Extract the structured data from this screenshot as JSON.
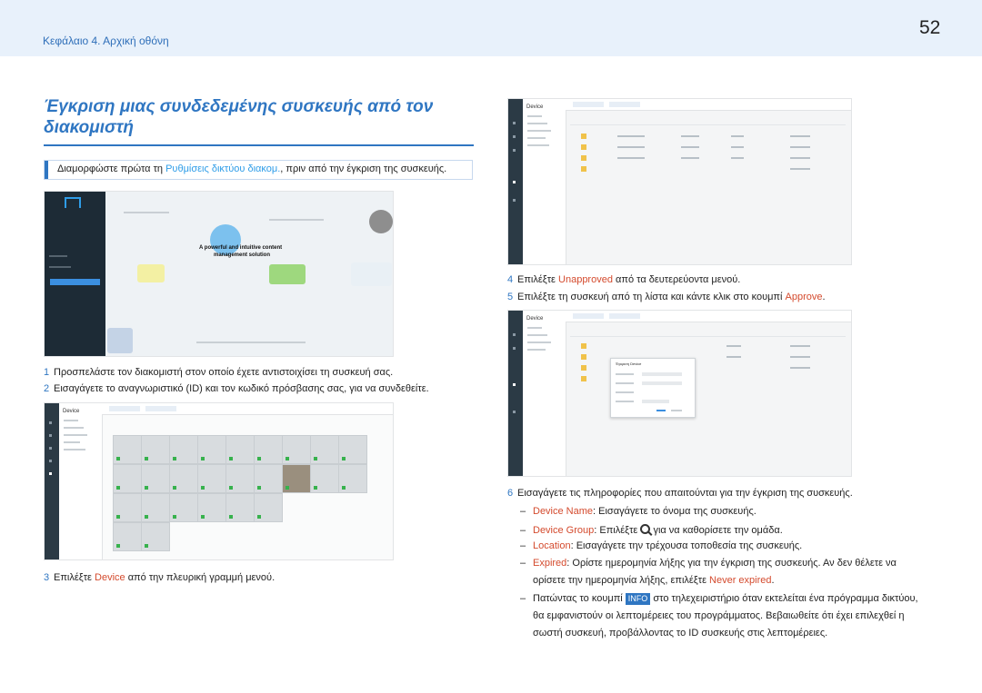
{
  "header": {
    "chapter": "Κεφάλαιο 4. Αρχική οθόνη",
    "page_number": "52"
  },
  "title": "Έγκριση μιας συνδεδεμένης συσκευής από τον διακομιστή",
  "note": {
    "prefix": "Διαμορφώστε πρώτα τη ",
    "link": "Ρυθμίσεις δικτύου διακομ.",
    "suffix": ", πριν από την έγκριση της συσκευής."
  },
  "login_screen": {
    "headline1": "A powerful and intuitive content",
    "headline2": "management solution"
  },
  "steps": [
    {
      "num": "1",
      "text": "Προσπελάστε τον διακομιστή στον οποίο έχετε αντιστοιχίσει τη συσκευή σας."
    },
    {
      "num": "2",
      "text": "Εισαγάγετε το αναγνωριστικό (ID) και τον κωδικό πρόσβασης σας, για να συνδεθείτε."
    },
    {
      "num": "3",
      "pre": "Επιλέξτε ",
      "hl": "Device",
      "post": " από την πλευρική γραμμή μενού."
    },
    {
      "num": "4",
      "pre": "Επιλέξτε ",
      "hl": "Unapproved",
      "post": " από τα δευτερεύοντα μενού."
    },
    {
      "num": "5",
      "pre": "Επιλέξτε τη συσκευή από τη λίστα και κάντε κλικ στο κουμπί ",
      "hl": "Approve",
      "post": "."
    },
    {
      "num": "6",
      "text": "Εισαγάγετε τις πληροφορίες που απαιτούνται για την έγκριση της συσκευής."
    }
  ],
  "screens": {
    "device_title": "Device",
    "dialog_title": "Έγκριση Device"
  },
  "bullets": {
    "name_label": "Device Name",
    "name_text": ": Εισαγάγετε το όνομα της συσκευής.",
    "group_label": "Device Group",
    "group_text_a": ": Επιλέξτε ",
    "group_text_b": " για να καθορίσετε την ομάδα.",
    "loc_label": "Location",
    "loc_text": ": Εισαγάγετε την τρέχουσα τοποθεσία της συσκευής.",
    "exp_label": "Expired",
    "exp_text": ": Ορίστε ημερομηνία λήξης για την έγκριση της συσκευής. Αν δεν θέλετε να",
    "exp_line2": "ορίσετε την ημερομηνία λήξης, επιλέξτε ",
    "exp_hl": "Never expired",
    "exp_end": ".",
    "info_a": "Πατώντας το κουμπί ",
    "info_btn": "INFO",
    "info_b": " στο τηλεχειριστήριο όταν εκτελείται ένα πρόγραμμα δικτύου,",
    "info_line2": "θα εμφανιστούν οι λεπτομέρειες του προγράμματος. Βεβαιωθείτε ότι έχει επιλεχθεί η",
    "info_line3": "σωστή συσκευή, προβάλλοντας το ID συσκευής στις λεπτομέρειες."
  },
  "colors": {
    "accent": "#2f76c2",
    "highlight": "#d44a2d",
    "link": "#2f9de8",
    "header_bg": "#e8f1fb"
  }
}
